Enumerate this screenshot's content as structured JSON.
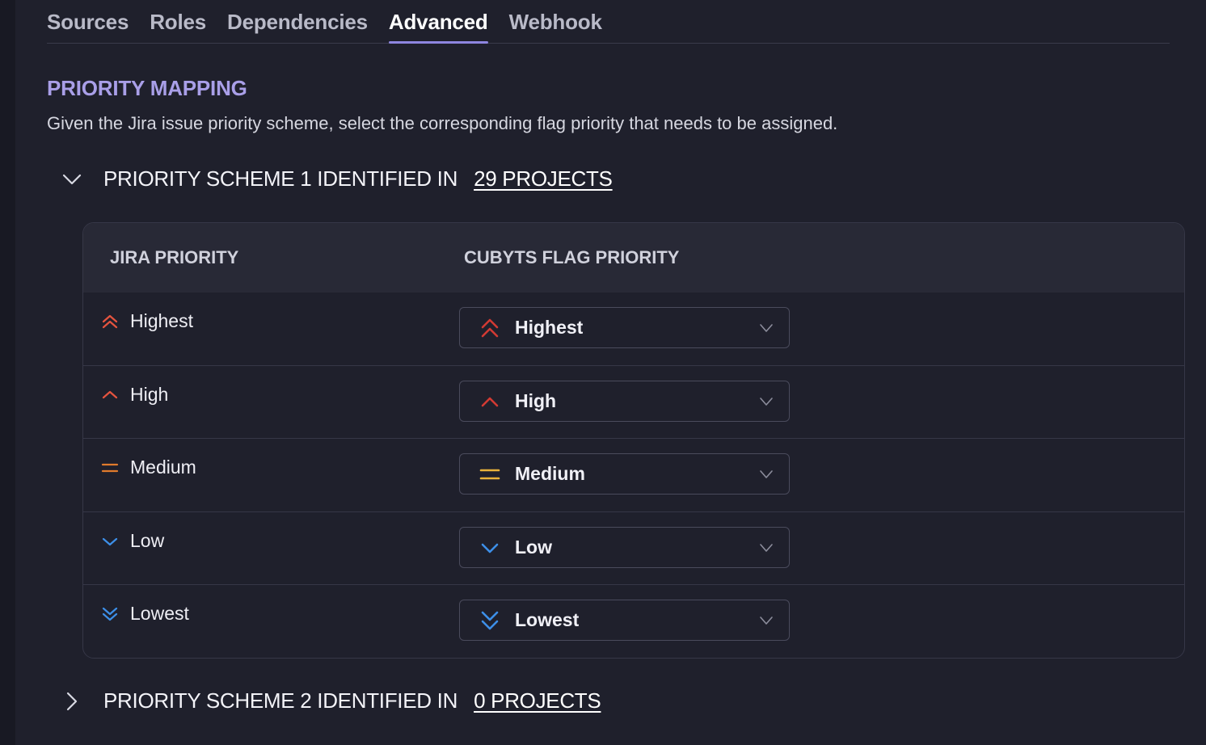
{
  "tabs": [
    {
      "label": "Sources"
    },
    {
      "label": "Roles"
    },
    {
      "label": "Dependencies"
    },
    {
      "label": "Advanced",
      "active": true
    },
    {
      "label": "Webhook"
    }
  ],
  "section": {
    "title": "PRIORITY MAPPING",
    "description": "Given the Jira issue priority scheme, select the corresponding flag priority that needs to be assigned."
  },
  "scheme1": {
    "label": "PRIORITY SCHEME 1 IDENTIFIED IN",
    "link": "29 PROJECTS",
    "expanded": true
  },
  "scheme2": {
    "label": "PRIORITY SCHEME 2 IDENTIFIED IN",
    "link": "0 PROJECTS",
    "expanded": false
  },
  "table": {
    "col_jira": "JIRA PRIORITY",
    "col_flag": "CUBYTS FLAG PRIORITY",
    "rows": [
      {
        "jira": "Highest",
        "flag": "Highest",
        "icon": "double-chevron-up-icon",
        "jira_color": "#e5543f",
        "flag_color": "#d23a33"
      },
      {
        "jira": "High",
        "flag": "High",
        "icon": "chevron-up-icon",
        "jira_color": "#e5543f",
        "flag_color": "#d23a33"
      },
      {
        "jira": "Medium",
        "flag": "Medium",
        "icon": "equals-icon",
        "jira_color": "#e07a2c",
        "flag_color": "#e8b23a"
      },
      {
        "jira": "Low",
        "flag": "Low",
        "icon": "chevron-down-icon",
        "jira_color": "#3d8fe8",
        "flag_color": "#3d8fe8"
      },
      {
        "jira": "Lowest",
        "flag": "Lowest",
        "icon": "double-chevron-down-icon",
        "jira_color": "#3d8fe8",
        "flag_color": "#3d8fe8"
      }
    ]
  },
  "colors": {
    "accent": "#8e86e0",
    "section_title": "#a99fe8",
    "background": "#1f202c"
  }
}
